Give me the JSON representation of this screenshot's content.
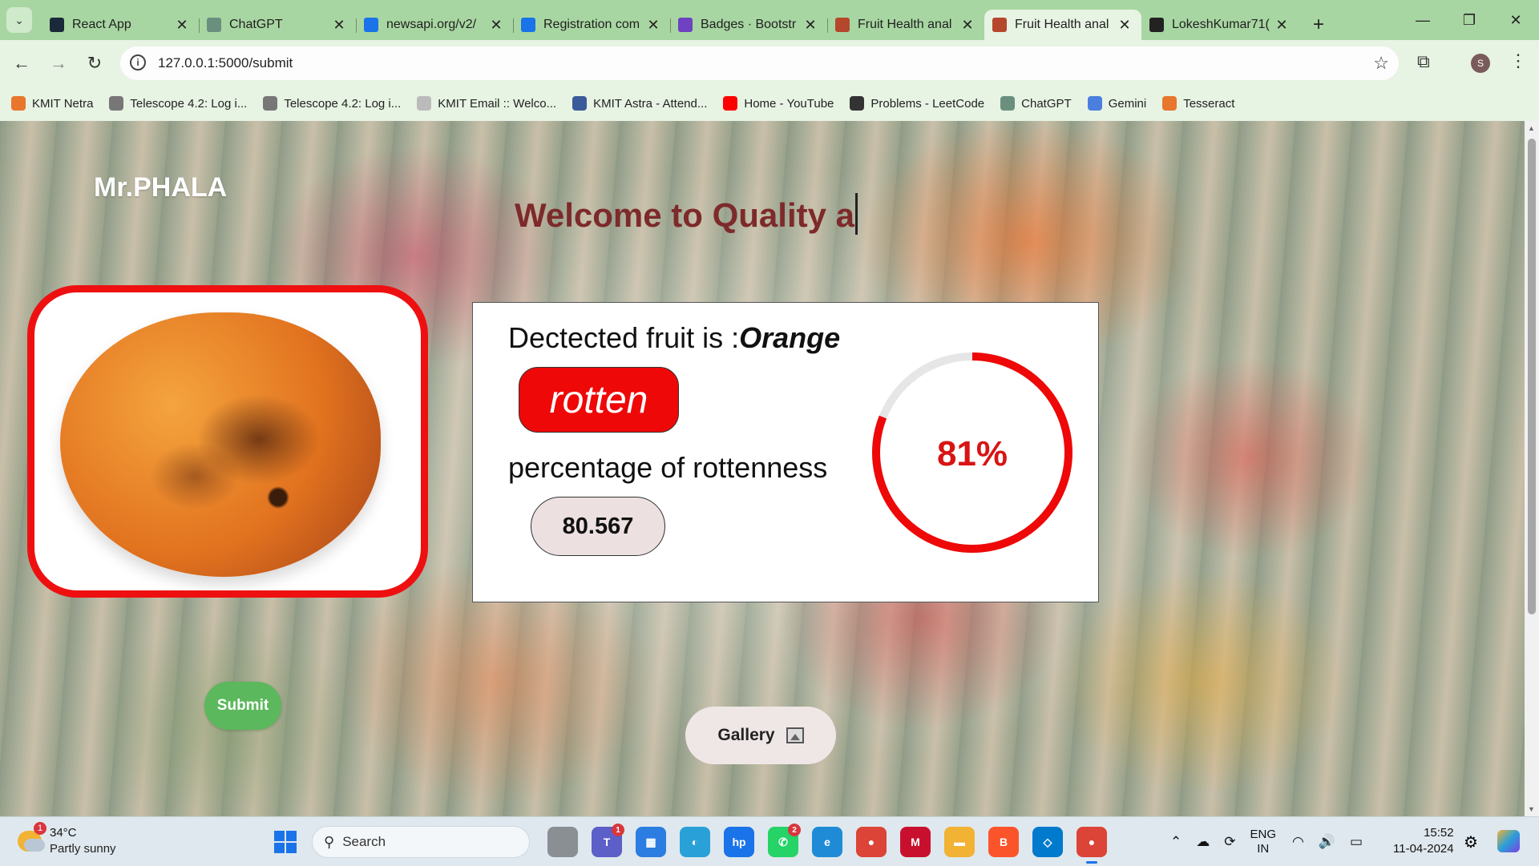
{
  "browser": {
    "tabs": [
      {
        "title": "React App",
        "icon": "react-icon",
        "color": "#1b2a3a"
      },
      {
        "title": "ChatGPT",
        "icon": "chatgpt-icon",
        "color": "#6b8f7e"
      },
      {
        "title": "newsapi.org/v2/",
        "icon": "doc-icon",
        "color": "#1a73e8"
      },
      {
        "title": "Registration com",
        "icon": "doc-icon",
        "color": "#1a73e8"
      },
      {
        "title": "Badges · Bootstr",
        "icon": "bootstrap-icon",
        "color": "#6f42c1"
      },
      {
        "title": "Fruit Health anal",
        "icon": "fruit-icon",
        "color": "#b5472d"
      },
      {
        "title": "Fruit Health anal",
        "icon": "fruit-icon",
        "color": "#b5472d",
        "active": true
      },
      {
        "title": "LokeshKumar71(",
        "icon": "github-icon",
        "color": "#222222"
      }
    ],
    "address": "127.0.0.1:5000/submit",
    "profile_initial": "S",
    "bookmarks": [
      {
        "label": "KMIT Netra",
        "color": "#e8762c"
      },
      {
        "label": "Telescope 4.2: Log i...",
        "color": "#777777"
      },
      {
        "label": "Telescope 4.2: Log i...",
        "color": "#777777"
      },
      {
        "label": "KMIT Email :: Welco...",
        "color": "#bbbbbb"
      },
      {
        "label": "KMIT Astra - Attend...",
        "color": "#3a5a9a"
      },
      {
        "label": "Home - YouTube",
        "color": "#ff0000"
      },
      {
        "label": "Problems - LeetCode",
        "color": "#333333"
      },
      {
        "label": "ChatGPT",
        "color": "#6b8f7e"
      },
      {
        "label": "Gemini",
        "color": "#4a7fe0"
      },
      {
        "label": "Tesseract",
        "color": "#e8762c"
      }
    ]
  },
  "page": {
    "brand": "Mr.PHALA",
    "welcome": "Welcome to Quality a",
    "result": {
      "detected_prefix": "Dectected fruit is :",
      "fruit": "Orange",
      "status": "rotten",
      "percentage_label": "percentage of rottenness",
      "percentage_value": "80.567",
      "gauge_text": "81%",
      "gauge_percent": 81,
      "accent": "#ee0808"
    },
    "submit_label": "Submit",
    "gallery_label": "Gallery"
  },
  "taskbar": {
    "weather_temp": "34°C",
    "weather_cond": "Partly sunny",
    "weather_badge": "1",
    "search_label": "Search",
    "lang_line1": "ENG",
    "lang_line2": "IN",
    "time": "15:52",
    "date": "11-04-2024",
    "apps": [
      {
        "name": "task-view-icon",
        "label": "",
        "color": "#8a8f94"
      },
      {
        "name": "teams-icon",
        "label": "T",
        "color": "#5b5fc7",
        "badge": "1"
      },
      {
        "name": "store-icon",
        "label": "▦",
        "color": "#2b7de1"
      },
      {
        "name": "copilot-icon",
        "label": "◐",
        "color": "#2aa0d8"
      },
      {
        "name": "myhp-icon",
        "label": "hp",
        "color": "#1a73e8"
      },
      {
        "name": "whatsapp-icon",
        "label": "✆",
        "color": "#25d366",
        "badge": "2"
      },
      {
        "name": "edge-icon",
        "label": "e",
        "color": "#1f8bd6"
      },
      {
        "name": "chrome-icon",
        "label": "●",
        "color": "#db4437"
      },
      {
        "name": "mcafee-icon",
        "label": "M",
        "color": "#c8102e"
      },
      {
        "name": "file-explorer-icon",
        "label": "▬",
        "color": "#f2b233"
      },
      {
        "name": "brave-icon",
        "label": "B",
        "color": "#fb542b"
      },
      {
        "name": "vscode-icon",
        "label": "◇",
        "color": "#007acc"
      },
      {
        "name": "chrome-profile-icon",
        "label": "●",
        "color": "#db4437",
        "active": true
      }
    ]
  }
}
